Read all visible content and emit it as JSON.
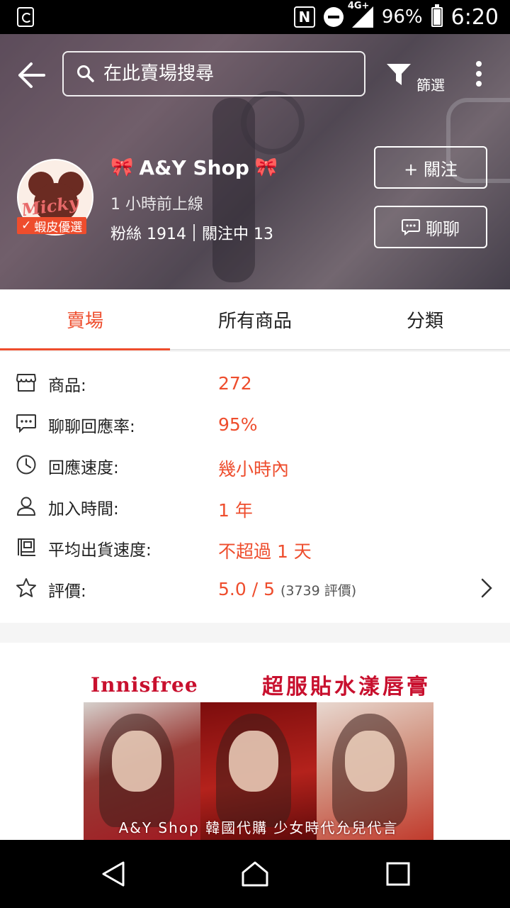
{
  "status_bar": {
    "nfc_label": "N",
    "network_label": "4G+",
    "battery": "96%",
    "time": "6:20"
  },
  "header": {
    "search_placeholder": "在此賣場搜尋",
    "filter_label": "篩選",
    "shop_name": "A&Y Shop",
    "shop_emoji_left": "🎀",
    "shop_emoji_right": "🎀",
    "avatar_text": "Micky",
    "preferred_badge": "蝦皮優選",
    "last_online": "1 小時前上線",
    "followers": "粉絲 1914",
    "following": "關注中 13",
    "follow_button": "+ 關注",
    "chat_button": "聊聊"
  },
  "tabs": [
    {
      "label": "賣場",
      "active": true
    },
    {
      "label": "所有商品",
      "active": false
    },
    {
      "label": "分類",
      "active": false
    }
  ],
  "shop_info": {
    "products": {
      "label": "商品:",
      "value": "272",
      "icon": "store-icon"
    },
    "chat_response_rate": {
      "label": "聊聊回應率:",
      "value": "95%",
      "icon": "chat-bubble-icon"
    },
    "response_speed": {
      "label": "回應速度:",
      "value": "幾小時內",
      "icon": "clock-icon"
    },
    "joined": {
      "label": "加入時間:",
      "value": "1 年",
      "icon": "person-icon"
    },
    "shipping_speed": {
      "label": "平均出貨速度:",
      "value": "不超過 1 天",
      "icon": "box-icon"
    },
    "rating": {
      "label": "評價:",
      "value": "5.0 / 5",
      "count": "(3739 評價)",
      "icon": "star-icon"
    }
  },
  "banner": {
    "title_brand": "Innisfree",
    "title_product": "超服貼水漾唇膏",
    "footer": "A&Y Shop 韓國代購 少女時代允兒代言"
  },
  "colors": {
    "accent": "#ee4d2d",
    "status_bar": "#000000",
    "nav_bar": "#000000"
  }
}
